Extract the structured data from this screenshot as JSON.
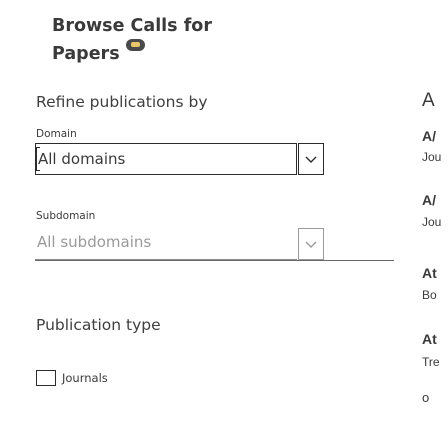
{
  "title": "Browse Calls for Papers",
  "filters": {
    "heading": "Refine publications by",
    "domain": {
      "label": "Domain",
      "value": "All domains"
    },
    "subdomain": {
      "label": "Subdomain",
      "value": "All subdomains"
    },
    "publication_type": {
      "heading": "Publication type",
      "option_journals": "Journals"
    }
  },
  "right_column": {
    "sort_letter": "A",
    "row1_title": "A/",
    "row1_sub": "Jou",
    "row2_title": "A/",
    "row2_sub": "Jou",
    "row3_title": "At",
    "row3_sub": "Bo",
    "row4_title": "At",
    "row4_sub": "Tre",
    "row5_sub": "o"
  },
  "colors": {
    "text": "#3a3a3a",
    "muted": "#9a9a9a",
    "border": "#2c2c2c"
  }
}
